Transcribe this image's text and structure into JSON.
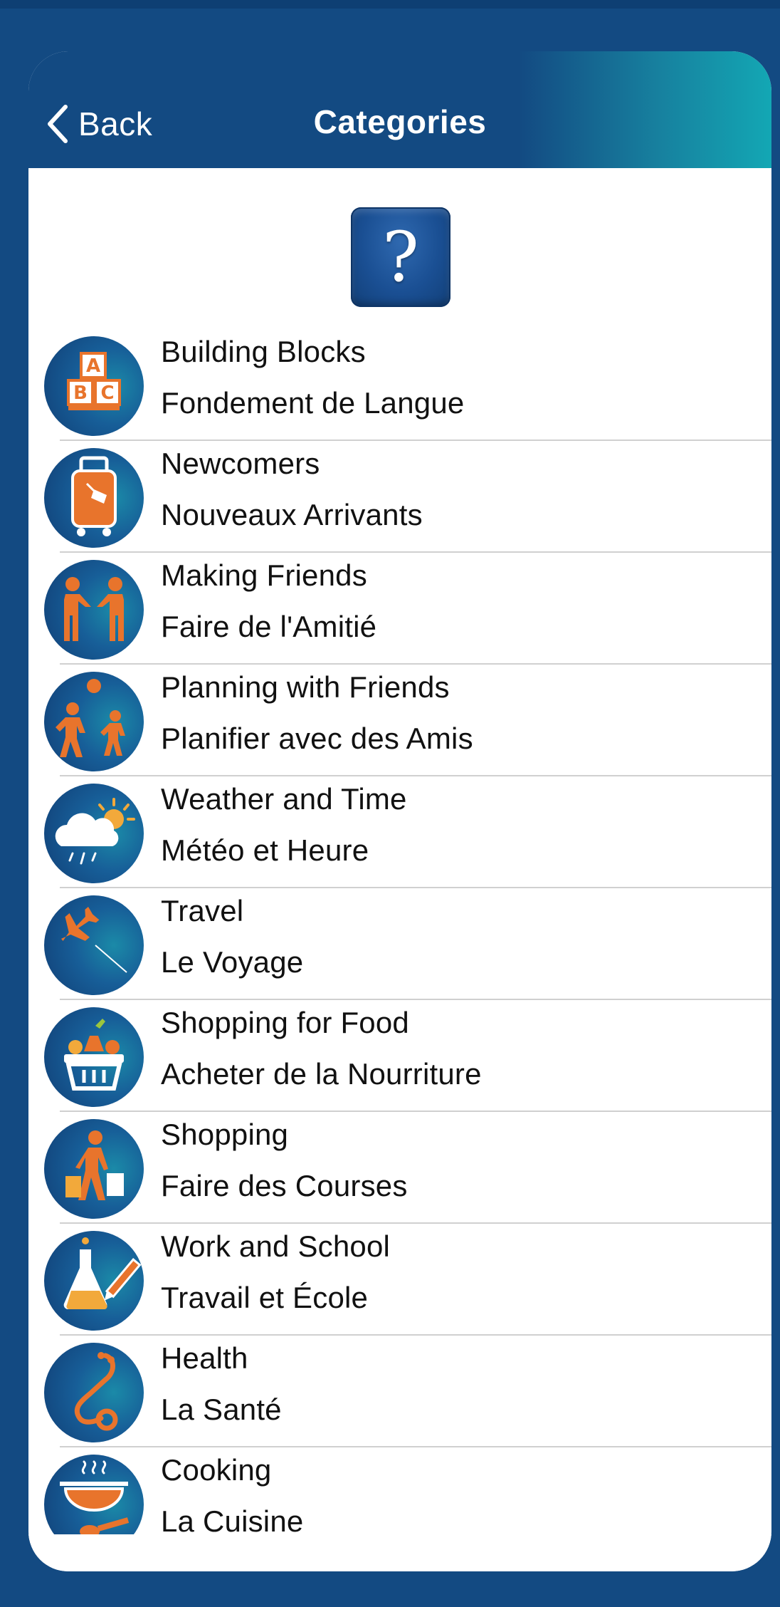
{
  "nav": {
    "back_label": "Back",
    "title": "Categories"
  },
  "help_button": {
    "glyph": "?"
  },
  "colors": {
    "frame": "#134a82",
    "navbar_gradient_end": "#13a7b4",
    "icon_accent": "#e8742c"
  },
  "categories": [
    {
      "en": "Building Blocks",
      "fr": "Fondement de Langue",
      "icon": "abc-blocks-icon"
    },
    {
      "en": "Newcomers",
      "fr": "Nouveaux Arrivants",
      "icon": "suitcase-icon"
    },
    {
      "en": "Making Friends",
      "fr": "Faire de l'Amitié",
      "icon": "handshake-icon"
    },
    {
      "en": "Planning with Friends",
      "fr": "Planifier avec des Amis",
      "icon": "friends-ball-icon"
    },
    {
      "en": "Weather and Time",
      "fr": "Météo et Heure",
      "icon": "weather-icon"
    },
    {
      "en": "Travel",
      "fr": "Le Voyage",
      "icon": "airplane-icon"
    },
    {
      "en": "Shopping for Food",
      "fr": "Acheter de la Nourriture",
      "icon": "grocery-basket-icon"
    },
    {
      "en": "Shopping",
      "fr": "Faire des Courses",
      "icon": "shopper-icon"
    },
    {
      "en": "Work and School",
      "fr": "Travail et École",
      "icon": "flask-pencil-icon"
    },
    {
      "en": "Health",
      "fr": "La Santé",
      "icon": "stethoscope-icon"
    },
    {
      "en": "Cooking",
      "fr": "La Cuisine",
      "icon": "cooking-pot-icon"
    }
  ]
}
